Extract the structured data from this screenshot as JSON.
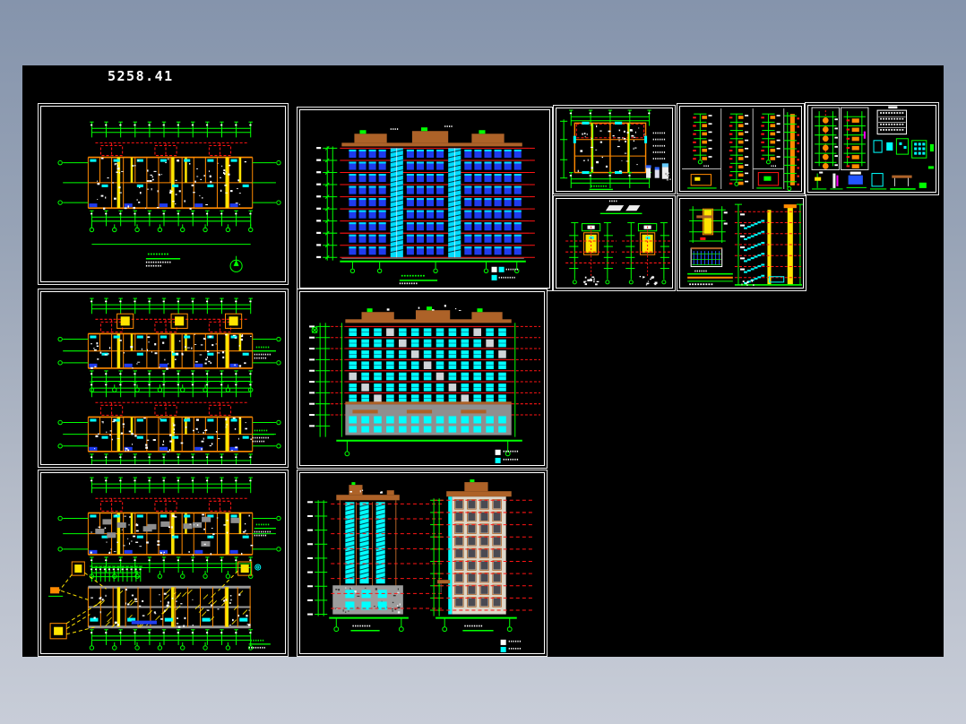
{
  "header": {
    "number": "5258.41"
  },
  "canvas": {
    "background": "#000000"
  },
  "desktop": {
    "gradient_top": "#8594ac",
    "gradient_bottom": "#c8cdd8"
  },
  "palette": {
    "green": "#00ff00",
    "red": "#ff1414",
    "cyan": "#00ffff",
    "yellow": "#ffe400",
    "orange": "#ff8a00",
    "blue": "#1f3bee",
    "skyblue": "#00dcff",
    "brown": "#ad6228",
    "gray": "#979797",
    "white": "#ffffff"
  },
  "panels": [
    {
      "name": "floor-plan-top"
    },
    {
      "name": "front-elevation"
    },
    {
      "name": "unit-plan-detail"
    },
    {
      "name": "wall-section-details"
    },
    {
      "name": "detail-sheet-with-table"
    },
    {
      "name": "stair-core-details"
    },
    {
      "name": "stair-section"
    },
    {
      "name": "middle-floor-plans"
    },
    {
      "name": "rear-elevation"
    },
    {
      "name": "roof-and-site-plans"
    },
    {
      "name": "side-elevations"
    }
  ]
}
